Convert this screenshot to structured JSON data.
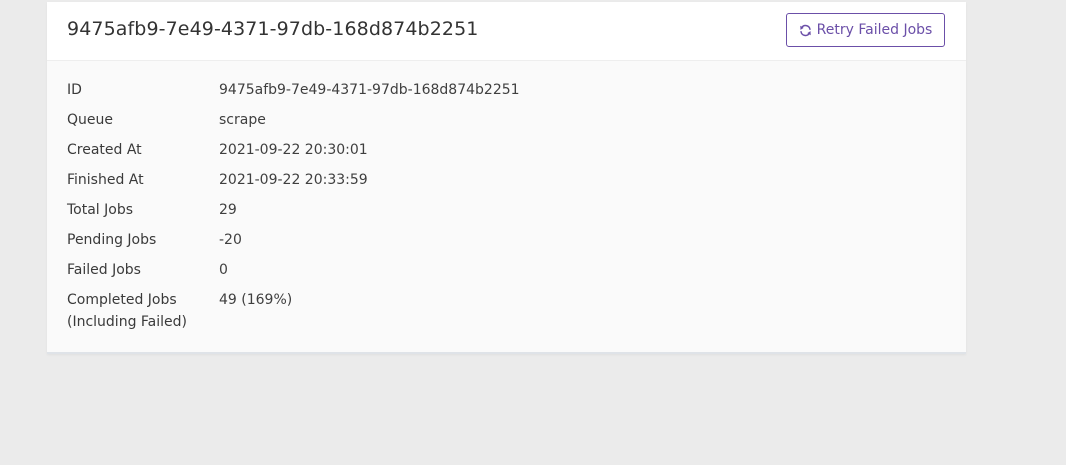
{
  "job": {
    "title": "9475afb9-7e49-4371-97db-168d874b2251",
    "retry_button_label": "Retry Failed Jobs",
    "retry_icon": "refresh-icon",
    "accent_color": "#6b4fa8"
  },
  "details": {
    "id": {
      "label": "ID",
      "value": "9475afb9-7e49-4371-97db-168d874b2251"
    },
    "queue": {
      "label": "Queue",
      "value": "scrape"
    },
    "created_at": {
      "label": "Created At",
      "value": "2021-09-22 20:30:01"
    },
    "finished_at": {
      "label": "Finished At",
      "value": "2021-09-22 20:33:59"
    },
    "total_jobs": {
      "label": "Total Jobs",
      "value": "29"
    },
    "pending_jobs": {
      "label": "Pending Jobs",
      "value": "-20"
    },
    "failed_jobs": {
      "label": "Failed Jobs",
      "value": "0"
    },
    "completed_jobs": {
      "label_line1": "Completed Jobs",
      "label_line2": "(Including Failed)",
      "value": "49 (169%)"
    }
  }
}
